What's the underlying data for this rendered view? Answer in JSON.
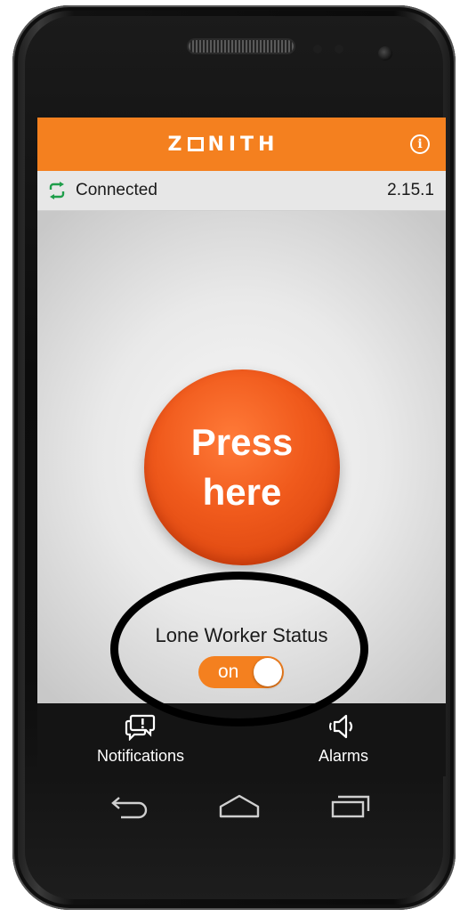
{
  "header": {
    "logo_text": "ZONITH",
    "logo_prefix": "Z",
    "logo_suffix": "NITH",
    "info_glyph": "i",
    "info_icon": "info-circle-icon"
  },
  "status": {
    "connection_icon": "sync-arrows-icon",
    "connection_label": "Connected",
    "version": "2.15.1"
  },
  "main": {
    "press_button_label": "Press\nhere",
    "lone_worker_label": "Lone Worker Status",
    "toggle_label": "on",
    "toggle_state": "on"
  },
  "bottom_nav": {
    "items": [
      {
        "label": "Notifications",
        "icon": "notification-bubble-icon"
      },
      {
        "label": "Alarms",
        "icon": "speaker-icon"
      }
    ]
  },
  "system_nav": {
    "buttons": [
      "back-icon",
      "home-icon",
      "recent-apps-icon"
    ]
  },
  "colors": {
    "accent": "#f4801f",
    "press_button": "#f05a1c",
    "status_bar": "#e7e7e7",
    "nav_bar": "#141414",
    "connected_icon": "#1f9e4a"
  }
}
